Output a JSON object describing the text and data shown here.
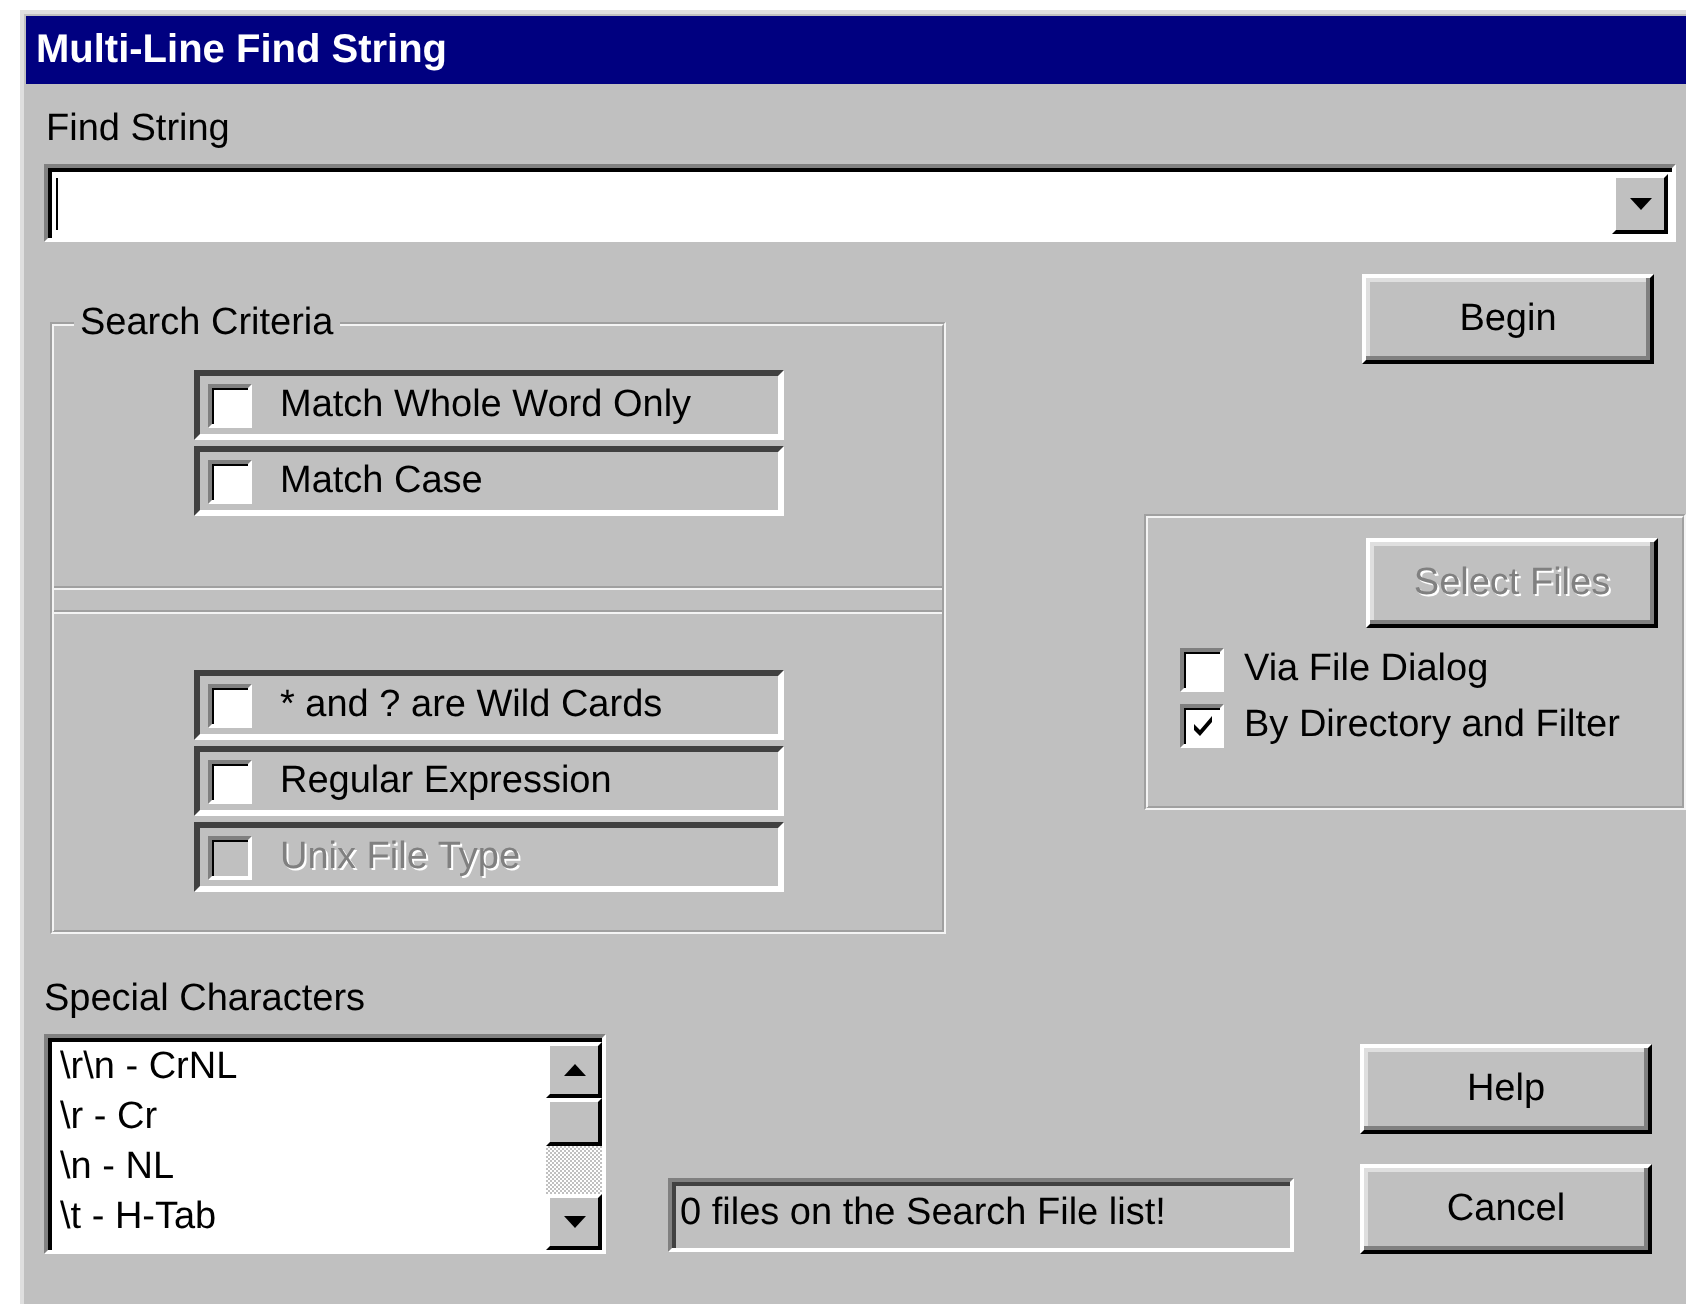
{
  "window": {
    "title": "Multi-Line Find String"
  },
  "find_string": {
    "label": "Find String"
  },
  "search_criteria": {
    "title": "Search Criteria",
    "match_options": [
      {
        "label": "Match Whole Word Only",
        "checked": false,
        "disabled": false
      },
      {
        "label": "Match Case",
        "checked": false,
        "disabled": false
      }
    ],
    "pattern_options": [
      {
        "label": "* and ? are Wild Cards",
        "checked": false,
        "disabled": false
      },
      {
        "label": "Regular Expression",
        "checked": false,
        "disabled": false
      },
      {
        "label": "Unix File Type",
        "checked": false,
        "disabled": true
      }
    ]
  },
  "begin_button": {
    "label": "Begin",
    "disabled": false
  },
  "file_selection": {
    "button": {
      "label": "Select Files",
      "disabled": true
    },
    "options": [
      {
        "label": "Via File Dialog",
        "checked": false,
        "disabled": false
      },
      {
        "label": "By Directory and Filter",
        "checked": true,
        "disabled": false
      }
    ]
  },
  "special_characters": {
    "label": "Special Characters",
    "items": [
      "\\r\\n - CrNL",
      "\\r - Cr",
      "\\n - NL",
      "\\t - H-Tab"
    ]
  },
  "status": "0 files on the Search File list!",
  "buttons": [
    {
      "label": "Help",
      "disabled": false
    },
    {
      "label": "Cancel",
      "disabled": false
    }
  ]
}
